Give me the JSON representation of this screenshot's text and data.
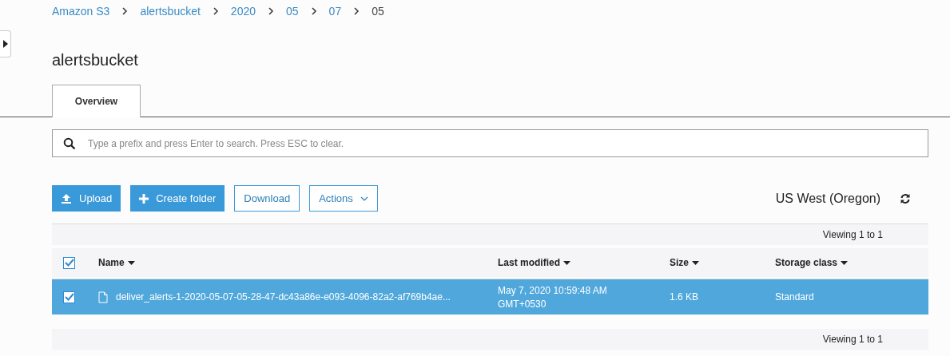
{
  "breadcrumb": [
    {
      "label": "Amazon S3",
      "current": false
    },
    {
      "label": "alertsbucket",
      "current": false
    },
    {
      "label": "2020",
      "current": false
    },
    {
      "label": "05",
      "current": false
    },
    {
      "label": "07",
      "current": false
    },
    {
      "label": "05",
      "current": true
    }
  ],
  "title": "alertsbucket",
  "tabs": [
    {
      "label": "Overview",
      "selected": true
    }
  ],
  "search": {
    "placeholder": "Type a prefix and press Enter to search. Press ESC to clear."
  },
  "buttons": [
    {
      "label": "Upload",
      "kind": "upload"
    },
    {
      "label": "Create folder",
      "kind": "create"
    },
    {
      "label": "Download",
      "kind": "outline"
    },
    {
      "label": "Actions",
      "kind": "dropdown"
    }
  ],
  "region": "US West (Oregon)",
  "table": {
    "viewing_top": "Viewing 1 to 1",
    "viewing_bottom": "Viewing 1 to 1",
    "select_all": {
      "checked": true
    },
    "columns": [
      "Name",
      "Last modified",
      "Size",
      "Storage class"
    ],
    "rows": [
      {
        "selected": true,
        "checked": true,
        "name": "deliver_alerts-1-2020-05-07-05-28-47-dc43a86e-e093-4096-82a2-af769b4ae...",
        "modified": [
          "May 7, 2020 10:59:48 AM",
          "GMT+0530"
        ],
        "size": "1.6 KB",
        "storage_class": "Standard"
      }
    ]
  }
}
